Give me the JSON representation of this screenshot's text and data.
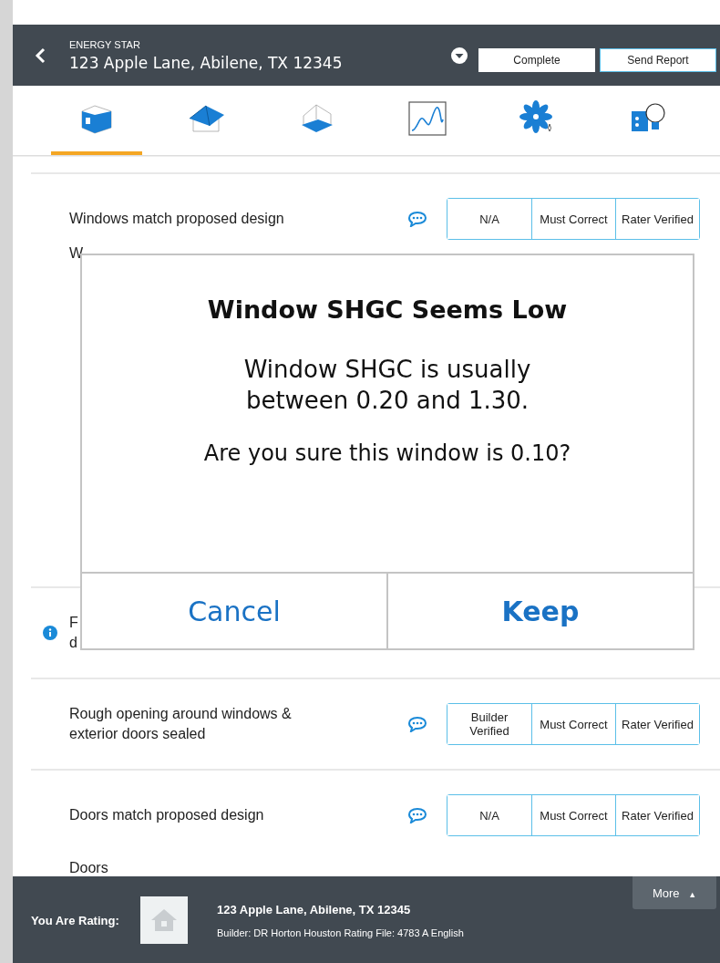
{
  "header": {
    "program": "ENERGY STAR",
    "address": "123 Apple Lane, Abilene, TX 12345",
    "buttons": [
      "Complete",
      "Send Report"
    ]
  },
  "tabs": [
    {
      "kind": "walls",
      "selected": true
    },
    {
      "kind": "roof",
      "selected": false
    },
    {
      "kind": "floor",
      "selected": false
    },
    {
      "kind": "graph",
      "selected": false
    },
    {
      "kind": "fan",
      "selected": false
    },
    {
      "kind": "electric",
      "selected": false
    }
  ],
  "checklist": [
    {
      "kind": "item",
      "lines": [
        "Windows match proposed design"
      ],
      "info": false,
      "options": [
        "N/A",
        "Must Correct",
        "Rater Verified"
      ]
    },
    {
      "kind": "covered_heading",
      "title": "W"
    },
    {
      "kind": "item",
      "lines": [
        "F",
        "d"
      ],
      "info": true
    },
    {
      "kind": "item",
      "lines": [
        "Rough opening around windows &",
        "exterior doors sealed"
      ],
      "info": false,
      "options": [
        "Builder Verified",
        "Must Correct",
        "Rater Verified"
      ]
    },
    {
      "kind": "item",
      "lines": [
        "Doors match proposed design"
      ],
      "info": false,
      "options": [
        "N/A",
        "Must Correct",
        "Rater Verified"
      ]
    },
    {
      "kind": "heading",
      "title": "Doors"
    }
  ],
  "dialog": {
    "title": "Window SHGC Seems Low",
    "message": "Window SHGC is usually between 0.20 and 1.30.",
    "question": "Are you sure this window is 0.10?",
    "buttons": [
      "Cancel",
      "Keep"
    ]
  },
  "footer": {
    "label": "You Are Rating:",
    "address": "123 Apple Lane, Abilene, TX 12345",
    "details": "Builder: DR Horton Houston Rating File: 4783 A English",
    "more": "More",
    "more_icon": "▲"
  }
}
